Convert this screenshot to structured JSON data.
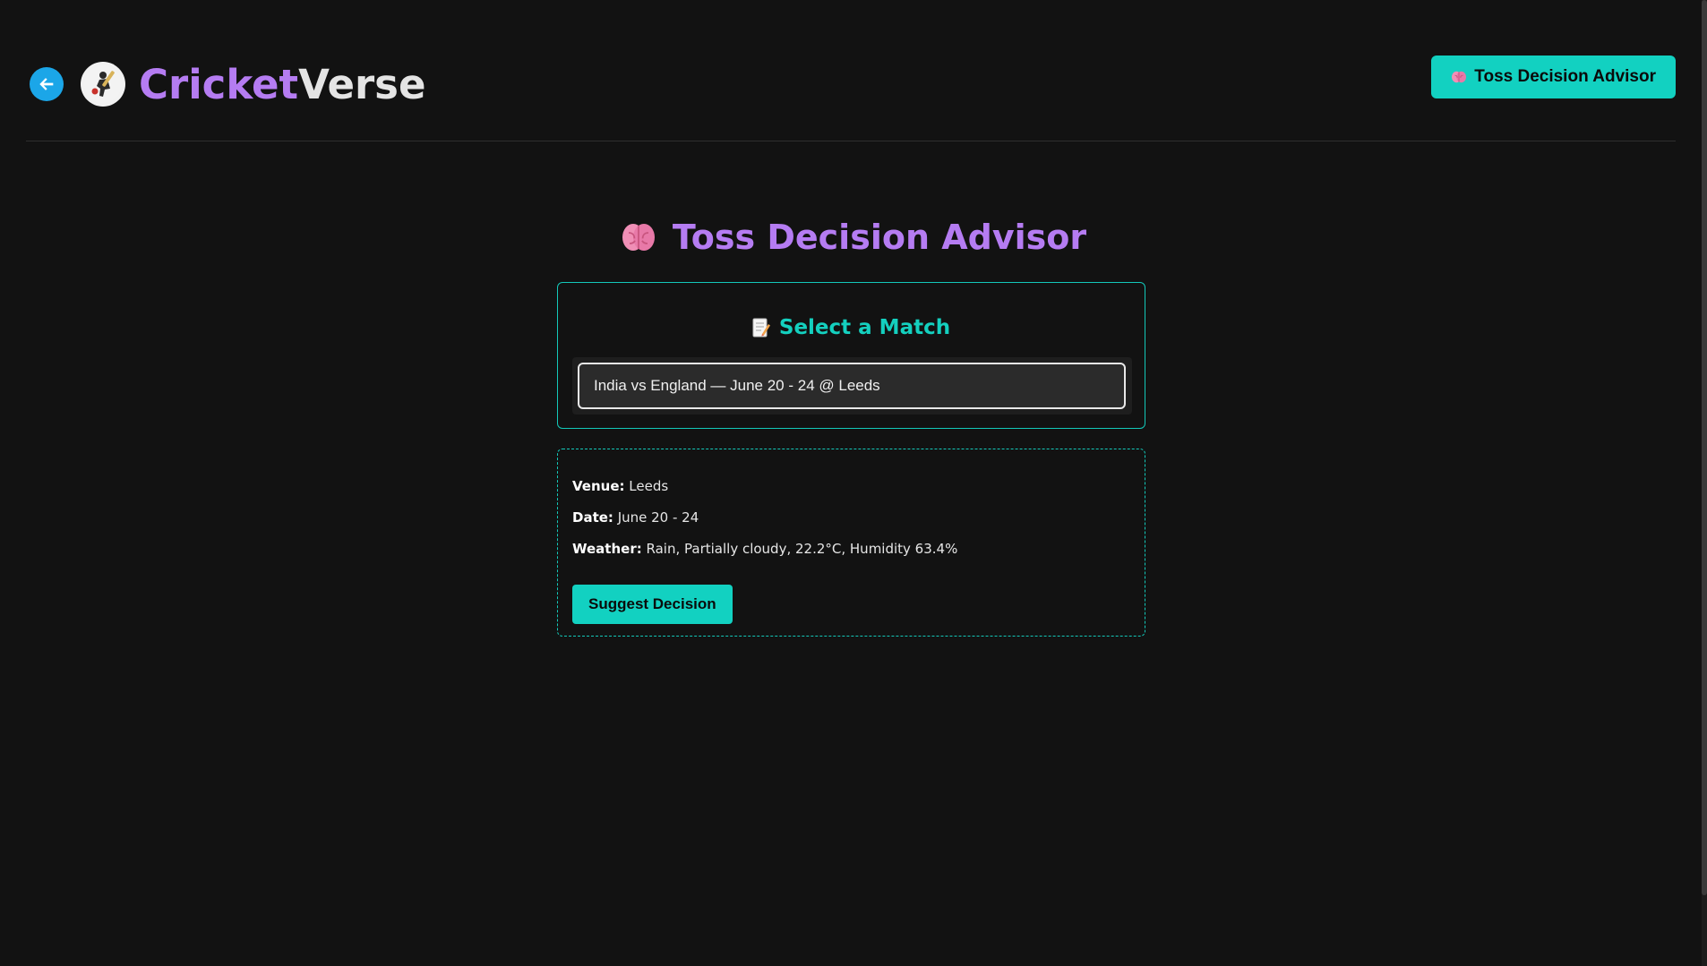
{
  "header": {
    "back_label": "Back",
    "brand_part1": "Cricket",
    "brand_part2": "Verse",
    "nav_button_label": "Toss Decision Advisor",
    "nav_button_icon": "brain-icon"
  },
  "main": {
    "title": "Toss Decision Advisor",
    "title_icon": "brain-icon",
    "select_card": {
      "heading": "Select a Match",
      "heading_icon": "memo-icon",
      "selected_match": "India vs England — June 20 - 24 @ Leeds"
    },
    "info": {
      "venue_label": "Venue:",
      "venue_value": "Leeds",
      "date_label": "Date:",
      "date_value": "June 20 - 24",
      "weather_label": "Weather:",
      "weather_value": "Rain, Partially cloudy, 22.2°C, Humidity 63.4%",
      "suggest_button_label": "Suggest Decision"
    }
  },
  "colors": {
    "background": "#121212",
    "accent_teal": "#12d1c1",
    "accent_purple": "#b57cf2",
    "back_button_blue": "#1ba6e8"
  }
}
